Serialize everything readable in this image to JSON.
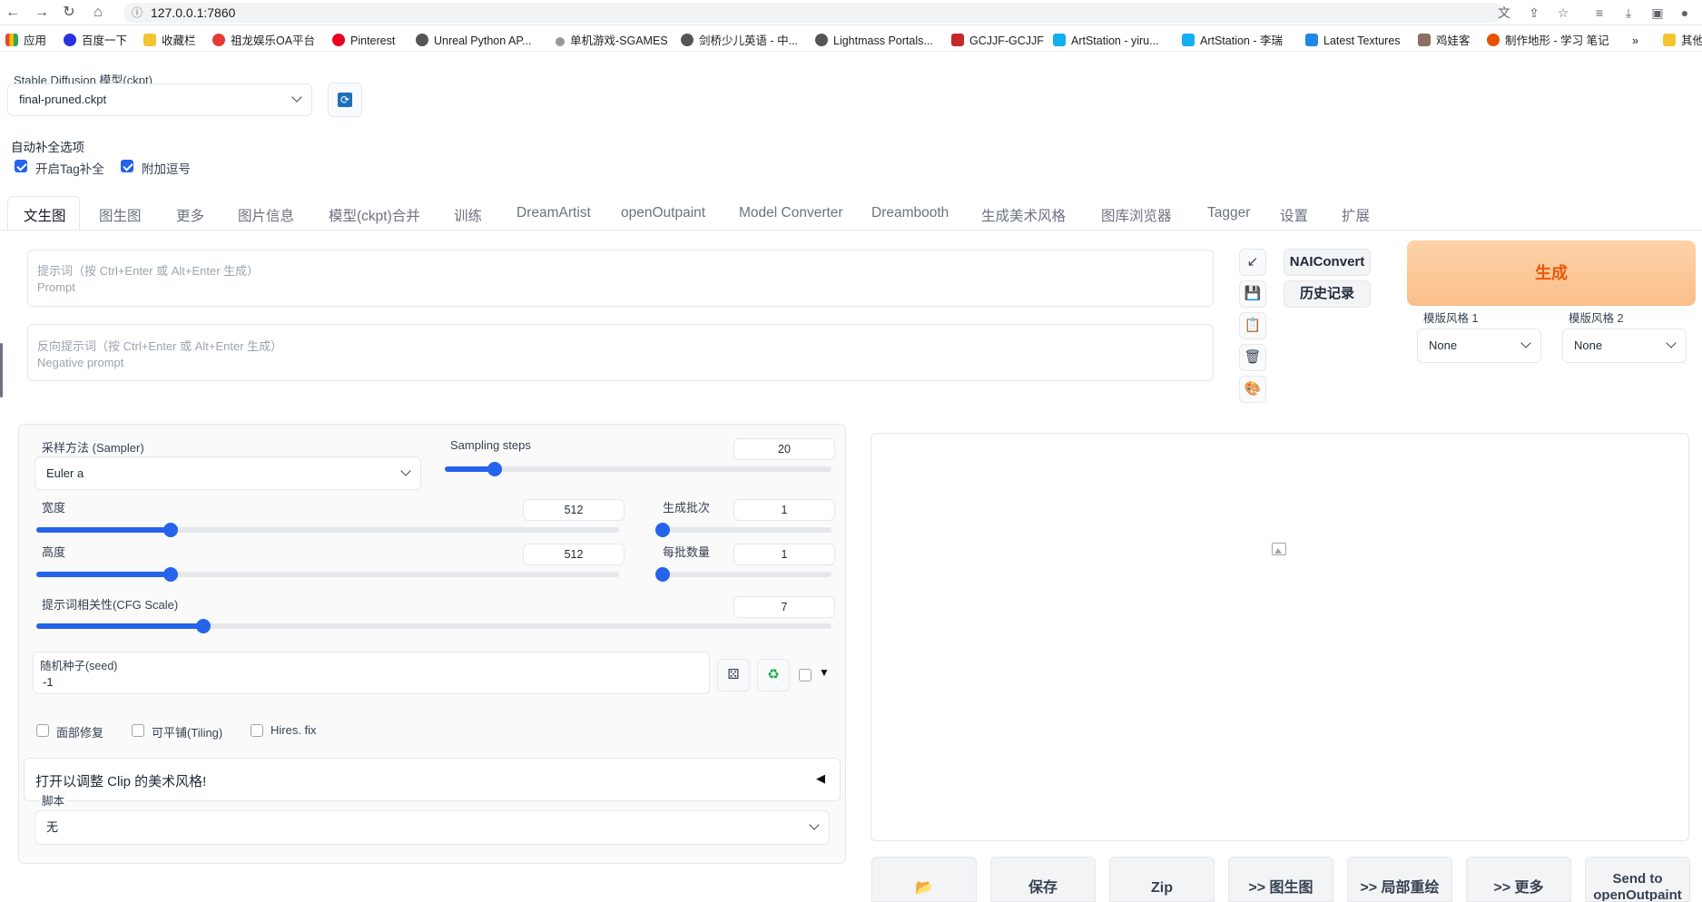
{
  "browser": {
    "url": "127.0.0.1:7860"
  },
  "bookmarks": [
    {
      "label": "应用",
      "color": "#ea4335"
    },
    {
      "label": "百度一下",
      "color": "#2932e1"
    },
    {
      "label": "收藏栏",
      "color": "#f4c430"
    },
    {
      "label": "祖龙娱乐OA平台",
      "color": "#e53935"
    },
    {
      "label": "Pinterest",
      "color": "#e60023"
    },
    {
      "label": "Unreal Python AP...",
      "color": "#333333"
    },
    {
      "label": "单机游戏-SGAMES",
      "color": "#888888"
    },
    {
      "label": "剑桥少儿英语 - 中...",
      "color": "#333333"
    },
    {
      "label": "Lightmass Portals...",
      "color": "#333333"
    },
    {
      "label": "GCJJF-GCJJF",
      "color": "#c62828"
    },
    {
      "label": "ArtStation - yiru...",
      "color": "#13aff0"
    },
    {
      "label": "ArtStation - 李瑞",
      "color": "#13aff0"
    },
    {
      "label": "Latest Textures",
      "color": "#1e88e5"
    },
    {
      "label": "鸡娃客",
      "color": "#8d6e63"
    },
    {
      "label": "制作地形 - 学习 笔记",
      "color": "#e65100"
    },
    {
      "label": "»",
      "color": ""
    },
    {
      "label": "其他",
      "color": "#f4c430"
    }
  ],
  "model": {
    "label": "Stable Diffusion 模型(ckpt)",
    "value": "final-pruned.ckpt"
  },
  "autocomplete": {
    "title": "自动补全选项",
    "opt1": "开启Tag补全",
    "opt2": "附加逗号"
  },
  "tabs": [
    "文生图",
    "图生图",
    "更多",
    "图片信息",
    "模型(ckpt)合并",
    "训练",
    "DreamArtist",
    "openOutpaint",
    "Model Converter",
    "Dreambooth",
    "生成美术风格",
    "图库浏览器",
    "Tagger",
    "设置",
    "扩展"
  ],
  "prompt": {
    "placeholder1": "提示词（按 Ctrl+Enter 或 Alt+Enter 生成）",
    "placeholder2": "Prompt"
  },
  "negprompt": {
    "placeholder1": "反向提示词（按 Ctrl+Enter 或 Alt+Enter 生成）",
    "placeholder2": "Negative prompt"
  },
  "tools": {
    "naiconvert": "NAIConvert",
    "history": "历史记录",
    "generate": "生成"
  },
  "styles": {
    "label1": "模版风格 1",
    "value1": "None",
    "label2": "模版风格 2",
    "value2": "None"
  },
  "settings": {
    "sampler_label": "采样方法 (Sampler)",
    "sampler_value": "Euler a",
    "steps_label": "Sampling steps",
    "steps_value": "20",
    "steps_fraction": 0.13,
    "width_label": "宽度",
    "width_value": "512",
    "width_fraction": 0.23,
    "batchcount_label": "生成批次",
    "batchcount_value": "1",
    "batchcount_fraction": 0.0,
    "height_label": "高度",
    "height_value": "512",
    "height_fraction": 0.23,
    "batchsize_label": "每批数量",
    "batchsize_value": "1",
    "batchsize_fraction": 0.0,
    "cfg_label": "提示词相关性(CFG Scale)",
    "cfg_value": "7",
    "cfg_fraction": 0.21,
    "seed_label": "随机种子(seed)",
    "seed_value": "-1",
    "facefix": "面部修复",
    "tiling": "可平铺(Tiling)",
    "hires": "Hires. fix",
    "clip_style": "打开以调整 Clip 的美术风格!",
    "script_label": "脚本",
    "script_value": "无"
  },
  "output_buttons": [
    "📂",
    "保存",
    "Zip",
    ">> 图生图",
    ">> 局部重绘",
    ">> 更多",
    "Send to openOutpaint"
  ]
}
